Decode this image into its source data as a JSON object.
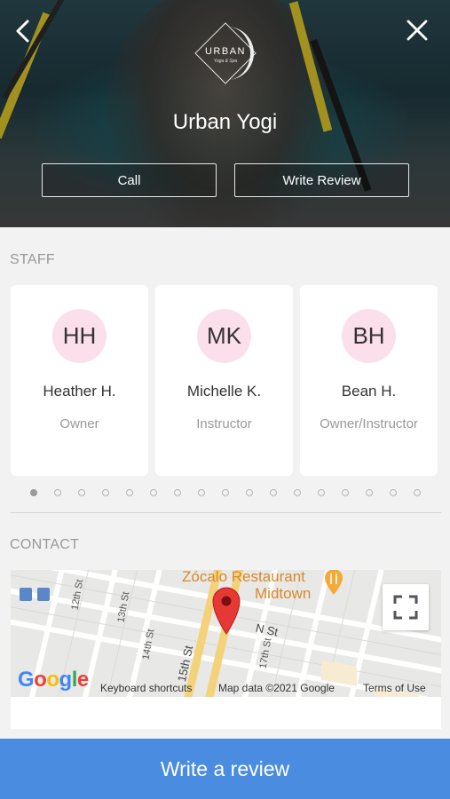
{
  "header": {
    "studio_name": "Urban Yogi",
    "logo_text": "URBAN",
    "logo_subtext": "Yoga & Spa",
    "call_label": "Call",
    "write_review_label": "Write Review"
  },
  "staff": {
    "section_label": "STAFF",
    "members": [
      {
        "initials": "HH",
        "name": "Heather H.",
        "role": "Owner"
      },
      {
        "initials": "MK",
        "name": "Michelle K.",
        "role": "Instructor"
      },
      {
        "initials": "BH",
        "name": "Bean H.",
        "role": "Owner/Instructor"
      }
    ],
    "page_count": 17,
    "active_page": 0
  },
  "contact": {
    "section_label": "CONTACT",
    "map": {
      "poi_name_line1": "Zócalo Restaurant",
      "poi_name_line2": "Midtown",
      "streets": [
        "12th St",
        "13th St",
        "14th St",
        "15th St",
        "17th St",
        "N St"
      ],
      "google": "Google",
      "keyboard_shortcuts": "Keyboard shortcuts",
      "map_data": "Map data ©2021 Google",
      "terms": "Terms of Use"
    }
  },
  "cta": {
    "label": "Write a review"
  },
  "colors": {
    "accent": "#4a8ce0",
    "avatar_bg": "#fbe0ec",
    "map_pin": "#e53935",
    "poi": "#d8892c"
  }
}
